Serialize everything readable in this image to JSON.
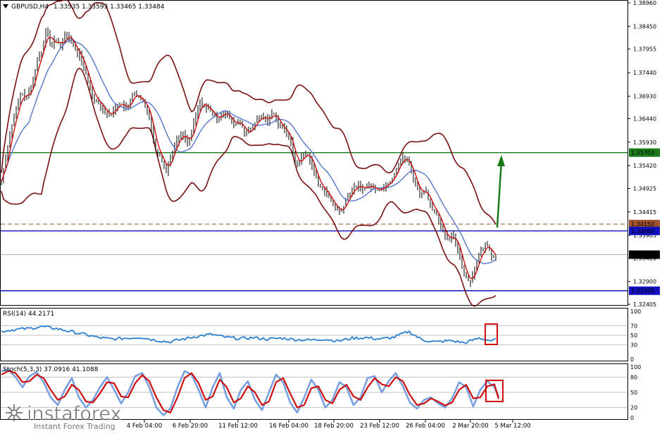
{
  "header": {
    "symbol_label": "GBPUSD,H4",
    "ohlc": "1.33535 1.33593 1.33465 1.33484",
    "icon": "triangle-down-icon"
  },
  "chart_data": [
    {
      "type": "candlestick",
      "symbol": "GBPUSD",
      "timeframe": "H4",
      "ohlc_last": {
        "open": 1.33535,
        "high": 1.33593,
        "low": 1.33465,
        "close": 1.33484
      },
      "y_ticks": [
        "1.38960",
        "1.38450",
        "1.37955",
        "1.37440",
        "1.36930",
        "1.36440",
        "1.35930",
        "1.35420",
        "1.34925",
        "1.34415",
        "1.33905",
        "1.33410",
        "1.32900",
        "1.32405"
      ],
      "ylim": [
        1.32405,
        1.3896
      ],
      "x_ticks": [
        "4 Feb 04:00",
        "6 Feb 20:00",
        "11 Feb 12:00",
        "16 Feb 04:00",
        "18 Feb 20:00",
        "23 Feb 12:00",
        "26 Feb 04:00",
        "2 Mar 20:00",
        "5 Mar 12:00"
      ],
      "price_labels": [
        {
          "value": "1.35703",
          "color": "#1a7a1a"
        },
        {
          "value": "1.34150",
          "color": "#a0522d"
        },
        {
          "value": "1.34000",
          "color": "#1010c0"
        },
        {
          "value": "1.33484",
          "color": "#000000"
        },
        {
          "value": "1.32700",
          "color": "#1010c0"
        }
      ],
      "horizontal_levels": [
        {
          "value": 1.35703,
          "color": "#1a7a1a",
          "style": "solid"
        },
        {
          "value": 1.3415,
          "color": "#a0522d",
          "style": "dashed"
        },
        {
          "value": 1.34,
          "color": "#1010c0",
          "style": "solid"
        },
        {
          "value": 1.327,
          "color": "#1010c0",
          "style": "solid"
        }
      ],
      "close_path": [
        [
          0,
          1.3487
        ],
        [
          6,
          1.3545
        ],
        [
          14,
          1.361
        ],
        [
          22,
          1.366
        ],
        [
          30,
          1.37
        ],
        [
          38,
          1.369
        ],
        [
          46,
          1.372
        ],
        [
          54,
          1.378
        ],
        [
          60,
          1.379
        ],
        [
          66,
          1.385
        ],
        [
          72,
          1.3795
        ],
        [
          78,
          1.382
        ],
        [
          86,
          1.38
        ],
        [
          94,
          1.383
        ],
        [
          102,
          1.381
        ],
        [
          108,
          1.379
        ],
        [
          114,
          1.378
        ],
        [
          120,
          1.375
        ],
        [
          126,
          1.372
        ],
        [
          132,
          1.369
        ],
        [
          140,
          1.368
        ],
        [
          148,
          1.366
        ],
        [
          156,
          1.365
        ],
        [
          164,
          1.367
        ],
        [
          172,
          1.368
        ],
        [
          180,
          1.366
        ],
        [
          188,
          1.37
        ],
        [
          196,
          1.369
        ],
        [
          204,
          1.368
        ],
        [
          212,
          1.365
        ],
        [
          220,
          1.358
        ],
        [
          228,
          1.356
        ],
        [
          236,
          1.353
        ],
        [
          244,
          1.357
        ],
        [
          252,
          1.36
        ],
        [
          260,
          1.361
        ],
        [
          268,
          1.359
        ],
        [
          276,
          1.364
        ],
        [
          284,
          1.368
        ],
        [
          292,
          1.367
        ],
        [
          300,
          1.366
        ],
        [
          308,
          1.364
        ],
        [
          316,
          1.366
        ],
        [
          324,
          1.365
        ],
        [
          332,
          1.363
        ],
        [
          340,
          1.364
        ],
        [
          348,
          1.361
        ],
        [
          356,
          1.362
        ],
        [
          364,
          1.364
        ],
        [
          372,
          1.365
        ],
        [
          380,
          1.364
        ],
        [
          388,
          1.366
        ],
        [
          396,
          1.363
        ],
        [
          404,
          1.362
        ],
        [
          412,
          1.36
        ],
        [
          420,
          1.354
        ],
        [
          428,
          1.356
        ],
        [
          436,
          1.357
        ],
        [
          444,
          1.354
        ],
        [
          452,
          1.35
        ],
        [
          460,
          1.349
        ],
        [
          468,
          1.347
        ],
        [
          476,
          1.345
        ],
        [
          484,
          1.344
        ],
        [
          492,
          1.347
        ],
        [
          500,
          1.349
        ],
        [
          508,
          1.35
        ],
        [
          516,
          1.349
        ],
        [
          524,
          1.35
        ],
        [
          532,
          1.349
        ],
        [
          540,
          1.349
        ],
        [
          548,
          1.35
        ],
        [
          556,
          1.351
        ],
        [
          564,
          1.354
        ],
        [
          572,
          1.356
        ],
        [
          580,
          1.355
        ],
        [
          588,
          1.351
        ],
        [
          596,
          1.348
        ],
        [
          604,
          1.349
        ],
        [
          612,
          1.345
        ],
        [
          620,
          1.344
        ],
        [
          628,
          1.34
        ],
        [
          636,
          1.338
        ],
        [
          644,
          1.339
        ],
        [
          652,
          1.335
        ],
        [
          660,
          1.33
        ],
        [
          668,
          1.329
        ],
        [
          676,
          1.333
        ],
        [
          684,
          1.336
        ],
        [
          692,
          1.337
        ],
        [
          700,
          1.334
        ],
        [
          706,
          1.33484
        ]
      ]
    },
    {
      "type": "line",
      "indicator": "RSI",
      "label": "RSI(14) 44.2171",
      "y_ticks": [
        "100",
        "70",
        "50",
        "30",
        "0"
      ],
      "ylim": [
        0,
        100
      ],
      "levels": [
        70,
        50,
        30
      ],
      "x": [
        0,
        20,
        40,
        60,
        80,
        100,
        120,
        140,
        160,
        180,
        200,
        220,
        240,
        260,
        280,
        300,
        320,
        340,
        360,
        380,
        400,
        420,
        440,
        460,
        480,
        500,
        520,
        540,
        560,
        580,
        600,
        620,
        640,
        660,
        680,
        700,
        706
      ],
      "values": [
        58,
        62,
        64,
        68,
        64,
        58,
        52,
        45,
        42,
        44,
        46,
        40,
        36,
        42,
        48,
        52,
        46,
        43,
        45,
        42,
        44,
        41,
        40,
        42,
        38,
        44,
        45,
        42,
        46,
        58,
        40,
        36,
        39,
        34,
        44,
        38,
        44.2
      ]
    },
    {
      "type": "line",
      "indicator": "Stochastic",
      "label": "Stoch(5,3,3) 37.0916 41.1088",
      "y_ticks": [
        "100",
        "80",
        "50",
        "20",
        "0"
      ],
      "ylim": [
        0,
        100
      ],
      "levels": [
        80,
        50,
        20
      ],
      "series": [
        {
          "name": "main",
          "x": [
            0,
            10,
            20,
            30,
            40,
            50,
            60,
            70,
            80,
            90,
            100,
            110,
            120,
            130,
            140,
            150,
            160,
            170,
            180,
            190,
            200,
            210,
            220,
            230,
            240,
            250,
            260,
            270,
            280,
            290,
            300,
            310,
            320,
            330,
            340,
            350,
            360,
            370,
            380,
            390,
            400,
            410,
            420,
            430,
            440,
            450,
            460,
            470,
            480,
            490,
            500,
            510,
            520,
            530,
            540,
            550,
            560,
            570,
            580,
            590,
            600,
            610,
            620,
            630,
            640,
            650,
            660,
            670,
            680,
            690,
            700,
            706
          ],
          "values": [
            92,
            95,
            80,
            60,
            82,
            90,
            70,
            40,
            25,
            55,
            78,
            40,
            20,
            35,
            60,
            80,
            55,
            28,
            50,
            82,
            88,
            60,
            20,
            5,
            18,
            60,
            92,
            85,
            55,
            20,
            60,
            88,
            40,
            18,
            55,
            72,
            35,
            15,
            50,
            85,
            70,
            30,
            10,
            40,
            75,
            55,
            20,
            35,
            70,
            60,
            25,
            40,
            78,
            82,
            50,
            72,
            88,
            62,
            30,
            18,
            35,
            40,
            28,
            20,
            38,
            70,
            60,
            22,
            55,
            72,
            60,
            41.1
          ]
        },
        {
          "name": "signal",
          "x": [
            0,
            10,
            20,
            30,
            40,
            50,
            60,
            70,
            80,
            90,
            100,
            110,
            120,
            130,
            140,
            150,
            160,
            170,
            180,
            190,
            200,
            210,
            220,
            230,
            240,
            250,
            260,
            270,
            280,
            290,
            300,
            310,
            320,
            330,
            340,
            350,
            360,
            370,
            380,
            390,
            400,
            410,
            420,
            430,
            440,
            450,
            460,
            470,
            480,
            490,
            500,
            510,
            520,
            530,
            540,
            550,
            560,
            570,
            580,
            590,
            600,
            610,
            620,
            630,
            640,
            650,
            660,
            670,
            680,
            690,
            700,
            706
          ],
          "values": [
            85,
            92,
            88,
            70,
            72,
            85,
            78,
            55,
            35,
            42,
            65,
            55,
            32,
            30,
            48,
            70,
            68,
            42,
            40,
            68,
            84,
            72,
            40,
            15,
            10,
            40,
            78,
            88,
            68,
            35,
            42,
            75,
            60,
            30,
            38,
            62,
            50,
            25,
            32,
            70,
            78,
            48,
            20,
            25,
            58,
            62,
            35,
            28,
            55,
            65,
            42,
            35,
            60,
            78,
            66,
            62,
            80,
            72,
            45,
            25,
            28,
            38,
            32,
            24,
            30,
            55,
            65,
            38,
            40,
            62,
            66,
            37.1
          ]
        }
      ]
    }
  ],
  "watermark": {
    "brand": "instaforex",
    "tagline": "Instant Forex Trading",
    "icon": "instaforex-logo-icon"
  }
}
